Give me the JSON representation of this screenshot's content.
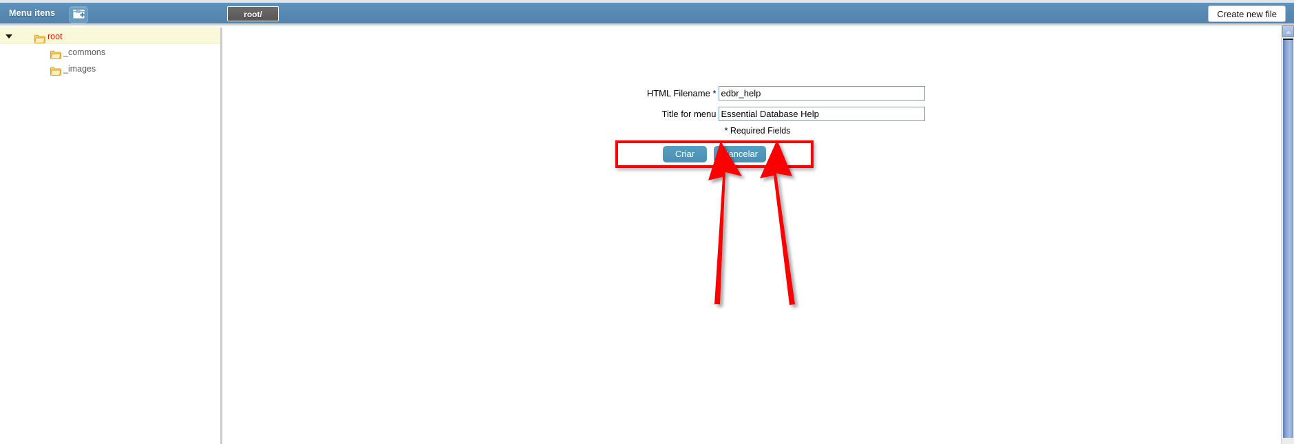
{
  "toolbar": {
    "menu_items_label": "Menu itens",
    "new_folder_icon": "new-folder-icon",
    "path_tab_label": "root/",
    "create_new_file_label": "Create new file"
  },
  "sidebar": {
    "tree": [
      {
        "label": "root",
        "icon": "folder-icon",
        "selected": true,
        "expanded": true,
        "depth": 0
      },
      {
        "label": "_commons",
        "icon": "folder-icon",
        "selected": false,
        "expanded": false,
        "depth": 1
      },
      {
        "label": "_images",
        "icon": "folder-icon",
        "selected": false,
        "expanded": false,
        "depth": 1
      }
    ]
  },
  "form": {
    "filename_label": "HTML Filename *",
    "filename_value": "edbr_help",
    "filename_placeholder": "",
    "title_label": "Title for menu",
    "title_value": "Essential Database Help",
    "title_placeholder": "",
    "required_note": "* Required Fields",
    "create_button_label": "Criar",
    "cancel_button_label": "Cancelar"
  },
  "annotations": {
    "highlight_color": "#fb0101",
    "arrow_color": "#fb0101",
    "arrow_count": 2
  },
  "colors": {
    "toolbar_blue": "#5688b2",
    "button_blue": "#4a90b6",
    "selected_row_yellow": "#f9f9d9",
    "root_label_red": "#cc2200",
    "scrollbar_blue": "#8fa9d6"
  },
  "scrollbar": {
    "up_arrow_icon": "chevron-up-icon"
  }
}
